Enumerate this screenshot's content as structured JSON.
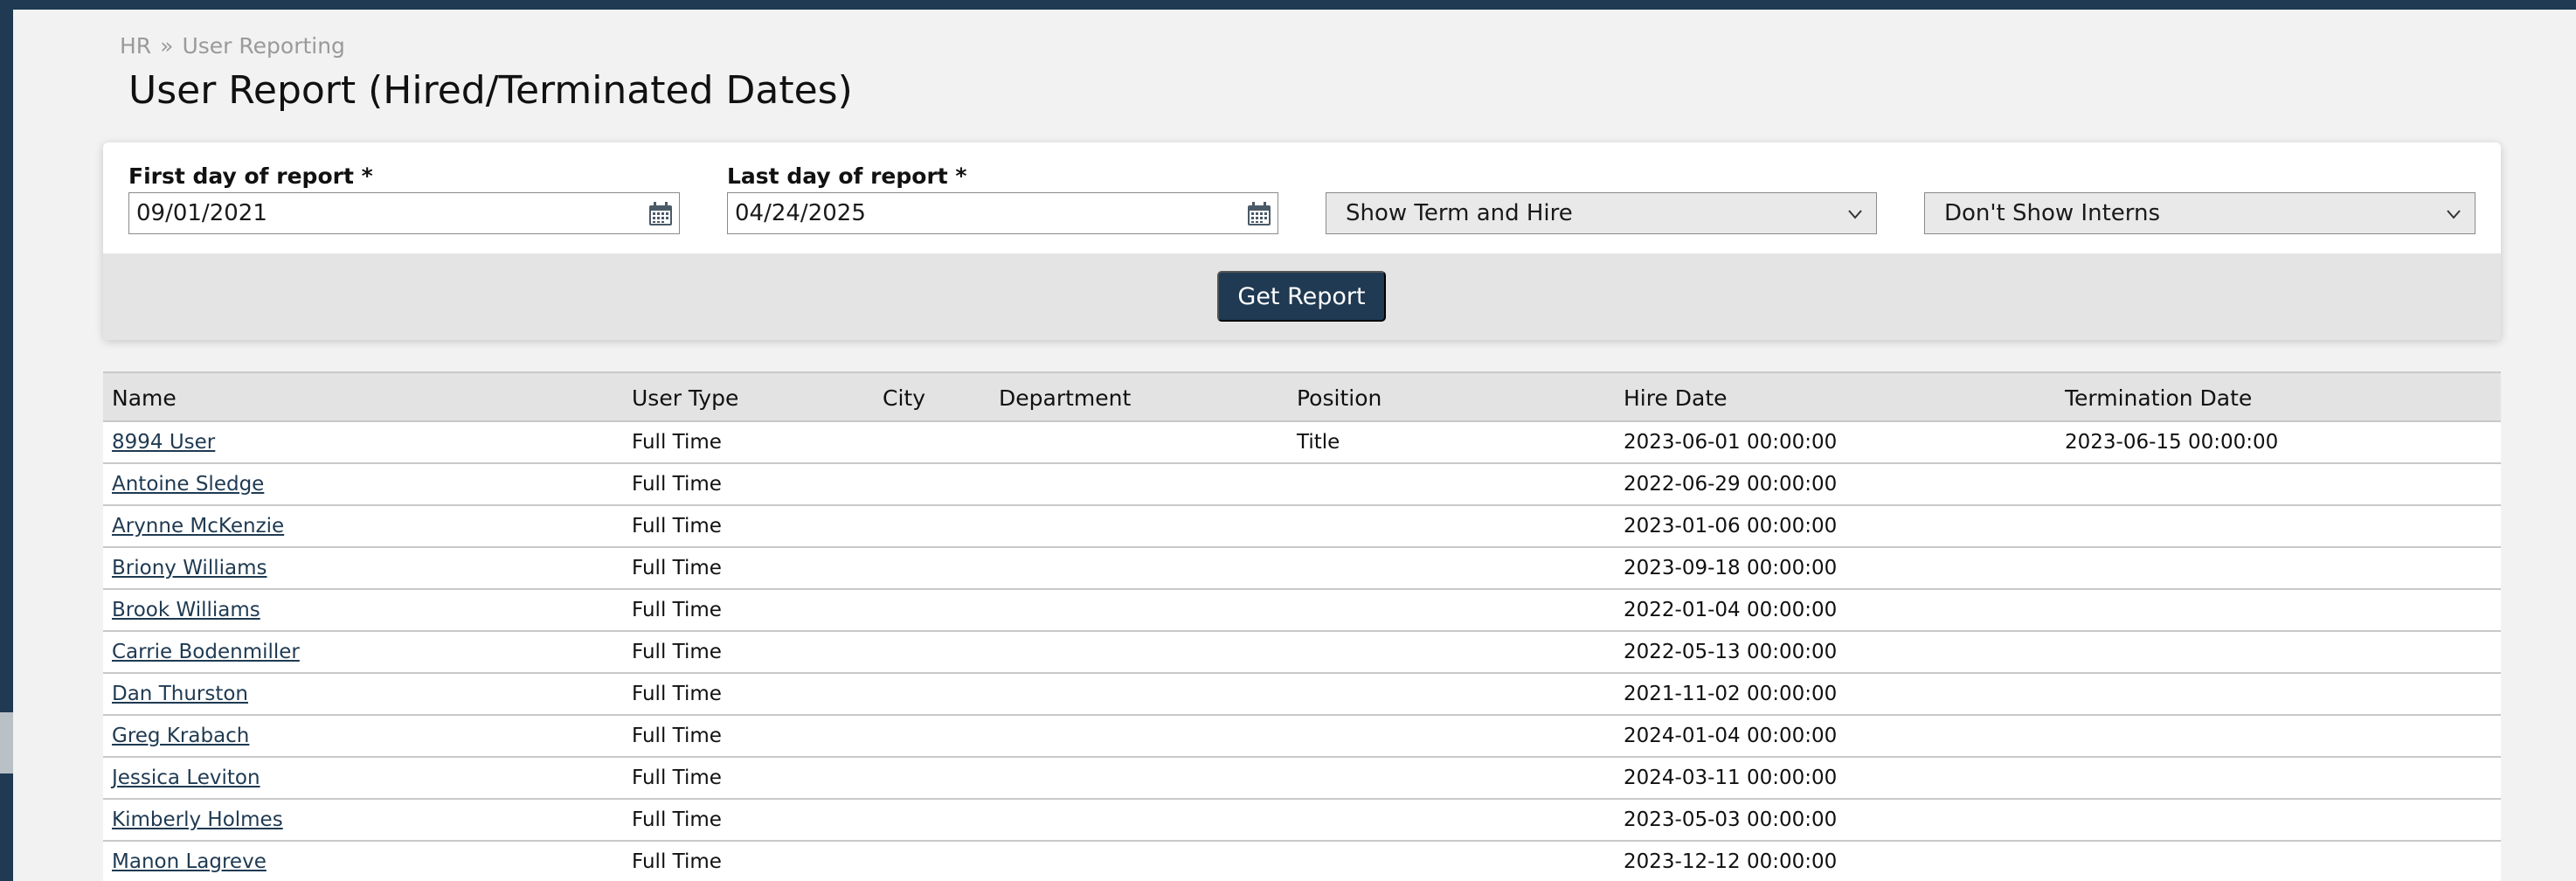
{
  "breadcrumb": {
    "items": [
      "HR",
      "User Reporting"
    ],
    "separator": "»"
  },
  "page_title": "User Report (Hired/Terminated Dates)",
  "filters": {
    "first_day_label": "First day of report *",
    "first_day_value": "09/01/2021",
    "last_day_label": "Last day of report *",
    "last_day_value": "04/24/2025",
    "show_filter_selected": "Show Term and Hire",
    "interns_filter_selected": "Don't Show Interns",
    "get_report_label": "Get Report"
  },
  "table": {
    "headers": {
      "name": "Name",
      "user_type": "User Type",
      "city": "City",
      "department": "Department",
      "position": "Position",
      "hire_date": "Hire Date",
      "termination_date": "Termination Date"
    },
    "rows": [
      {
        "name": "8994 User",
        "user_type": "Full Time",
        "city": "",
        "department": "",
        "position": "Title",
        "hire_date": "2023-06-01 00:00:00",
        "termination_date": "2023-06-15 00:00:00"
      },
      {
        "name": "Antoine Sledge",
        "user_type": "Full Time",
        "city": "",
        "department": "",
        "position": "",
        "hire_date": "2022-06-29 00:00:00",
        "termination_date": ""
      },
      {
        "name": "Arynne McKenzie",
        "user_type": "Full Time",
        "city": "",
        "department": "",
        "position": "",
        "hire_date": "2023-01-06 00:00:00",
        "termination_date": ""
      },
      {
        "name": "Briony Williams",
        "user_type": "Full Time",
        "city": "",
        "department": "",
        "position": "",
        "hire_date": "2023-09-18 00:00:00",
        "termination_date": ""
      },
      {
        "name": "Brook Williams",
        "user_type": "Full Time",
        "city": "",
        "department": "",
        "position": "",
        "hire_date": "2022-01-04 00:00:00",
        "termination_date": ""
      },
      {
        "name": "Carrie Bodenmiller",
        "user_type": "Full Time",
        "city": "",
        "department": "",
        "position": "",
        "hire_date": "2022-05-13 00:00:00",
        "termination_date": ""
      },
      {
        "name": "Dan Thurston",
        "user_type": "Full Time",
        "city": "",
        "department": "",
        "position": "",
        "hire_date": "2021-11-02 00:00:00",
        "termination_date": ""
      },
      {
        "name": "Greg Krabach",
        "user_type": "Full Time",
        "city": "",
        "department": "",
        "position": "",
        "hire_date": "2024-01-04 00:00:00",
        "termination_date": ""
      },
      {
        "name": "Jessica Leviton",
        "user_type": "Full Time",
        "city": "",
        "department": "",
        "position": "",
        "hire_date": "2024-03-11 00:00:00",
        "termination_date": ""
      },
      {
        "name": "Kimberly Holmes",
        "user_type": "Full Time",
        "city": "",
        "department": "",
        "position": "",
        "hire_date": "2023-05-03 00:00:00",
        "termination_date": ""
      },
      {
        "name": "Manon Lagreve",
        "user_type": "Full Time",
        "city": "",
        "department": "",
        "position": "",
        "hire_date": "2023-12-12 00:00:00",
        "termination_date": ""
      }
    ]
  },
  "icons": {
    "calendar": "calendar-icon",
    "dropdown": "chevron-down-icon"
  },
  "colors": {
    "brand": "#1f3a52",
    "link": "#1f3a52"
  }
}
